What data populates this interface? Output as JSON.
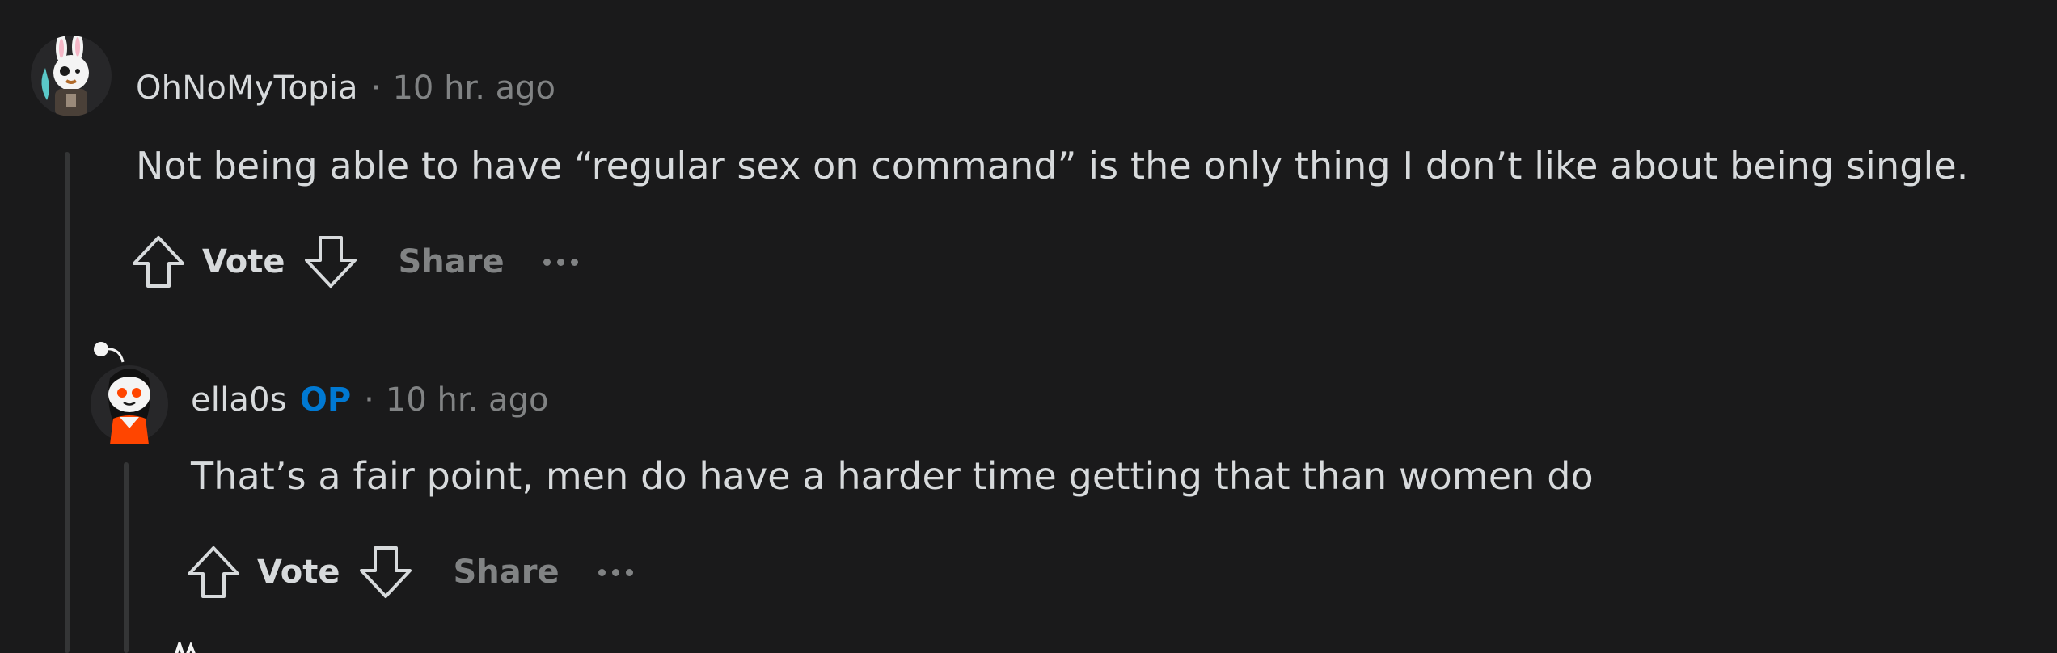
{
  "colors": {
    "background": "#1a1a1b",
    "text": "#d7dadc",
    "muted": "#818384",
    "op_badge": "#0079d3",
    "thread_line": "#343536"
  },
  "comments": [
    {
      "username": "OhNoMyTopia",
      "separator": "·",
      "timestamp": "10 hr. ago",
      "body": "Not being able to have “regular sex on command” is the only thing I don’t like about being single.",
      "vote_label": "Vote",
      "share_label": "Share",
      "avatar_icon": "bunny-avatar-icon"
    },
    {
      "username": "ella0s",
      "op_badge": "OP",
      "separator": "·",
      "timestamp": "10 hr. ago",
      "body": "That’s a fair point, men do have a harder time getting that than women do",
      "vote_label": "Vote",
      "share_label": "Share",
      "avatar_icon": "snoo-avatar-icon"
    }
  ]
}
